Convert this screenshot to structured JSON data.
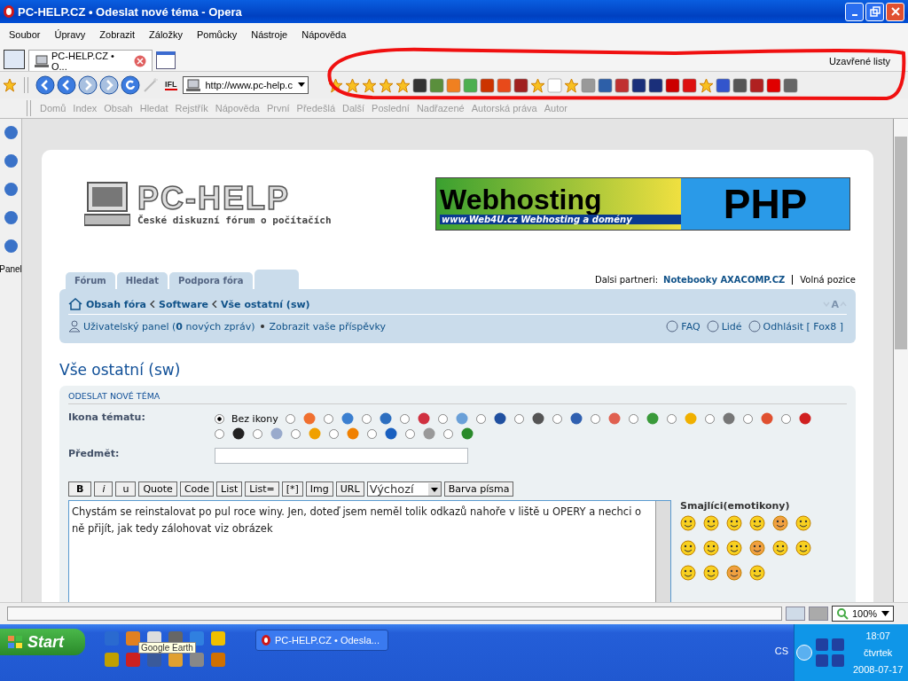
{
  "window": {
    "title": "PC-HELP.CZ • Odeslat nové téma - Opera"
  },
  "menu": [
    "Soubor",
    "Úpravy",
    "Zobrazit",
    "Záložky",
    "Pomůcky",
    "Nástroje",
    "Nápověda"
  ],
  "tabs": [
    {
      "label": "PC-HELP.CZ • O...",
      "selected": true
    }
  ],
  "closed_tabs": "Uzavřené listy",
  "address": {
    "value": "http://www.pc-help.c"
  },
  "search_engine": "IFL",
  "nav_links": [
    {
      "label": "Domů",
      "disabled": true
    },
    {
      "label": "Index",
      "disabled": true
    },
    {
      "label": "Obsah",
      "disabled": true
    },
    {
      "label": "Hledat",
      "disabled": true
    },
    {
      "label": "Rejstřík",
      "disabled": true
    },
    {
      "label": "Nápověda",
      "disabled": true
    },
    {
      "label": "První",
      "disabled": true
    },
    {
      "label": "Předešlá",
      "disabled": true
    },
    {
      "label": "Další",
      "disabled": true
    },
    {
      "label": "Poslední",
      "disabled": true
    },
    {
      "label": "Nadřazené",
      "disabled": true
    },
    {
      "label": "Autorská práva",
      "disabled": true
    },
    {
      "label": "Autor",
      "disabled": true
    }
  ],
  "side_panel": {
    "label": "Panel"
  },
  "forum": {
    "logo": "PC-HELP",
    "tagline": "České diskuzní fórum o počítačích",
    "banner": {
      "title": "Webhosting",
      "product": "PHP",
      "caption": "www.Web4U.cz  Webhosting a domény"
    },
    "tabs": [
      "Fórum",
      "Hledat",
      "Podpora fóra"
    ],
    "partners": {
      "label": "Dalsi partneri:",
      "link": "Notebooky AXACOMP.CZ",
      "other": "Volná pozice"
    },
    "breadcrumbs": [
      "Obsah fóra",
      "Software",
      "Vše ostatní (sw)"
    ],
    "font_size": "A",
    "user_panel": "Uživatelský panel (**0** nových zpráv)",
    "view_posts": "Zobrazit vaše příspěvky",
    "right_links": [
      "FAQ",
      "Lidé",
      "Odhlásit [ Fox8 ]"
    ],
    "heading": "Vše ostatní (sw)",
    "form": {
      "title": "ODESLAT NOVÉ TÉMA",
      "icon_label": "Ikona tématu:",
      "icon_options": [
        {
          "label": "Bez ikony",
          "selected": true
        },
        {
          "selected": false
        },
        {
          "selected": false
        },
        {
          "selected": false
        },
        {
          "selected": false
        },
        {
          "selected": false
        },
        {
          "selected": false
        },
        {
          "selected": false
        },
        {
          "selected": false
        },
        {
          "selected": false
        },
        {
          "selected": false
        },
        {
          "selected": false
        },
        {
          "selected": false
        },
        {
          "selected": false
        },
        {
          "selected": false
        },
        {
          "selected": false
        },
        {
          "selected": false
        },
        {
          "selected": false
        },
        {
          "selected": false
        },
        {
          "selected": false
        },
        {
          "selected": false
        },
        {
          "selected": false
        }
      ],
      "subject_label": "Předmět:",
      "format_buttons": [
        "B",
        "i",
        "u",
        "Quote",
        "Code",
        "List",
        "List=",
        "[*]",
        "Img",
        "URL"
      ],
      "font_select": "Výchozí",
      "color_button": "Barva písma",
      "message": "Chystám se reinstalovat po pul roce winy. Jen, doteď jsem neměl tolik odkazů nahoře v liště u OPERY a nechci  o ně přijít, jak tedy zálohovat viz obrázek",
      "smileys_title": "Smajlíci(emotikony)"
    }
  },
  "status_bar": {
    "zoom": "100%"
  },
  "taskbar": {
    "start": "Start",
    "tooltip": "Google Earth",
    "tasks": [
      "PC-HELP.CZ • Odesla..."
    ],
    "language": "CS",
    "time": "18:07",
    "day": "čtvrtek",
    "date": "2008-07-17"
  }
}
